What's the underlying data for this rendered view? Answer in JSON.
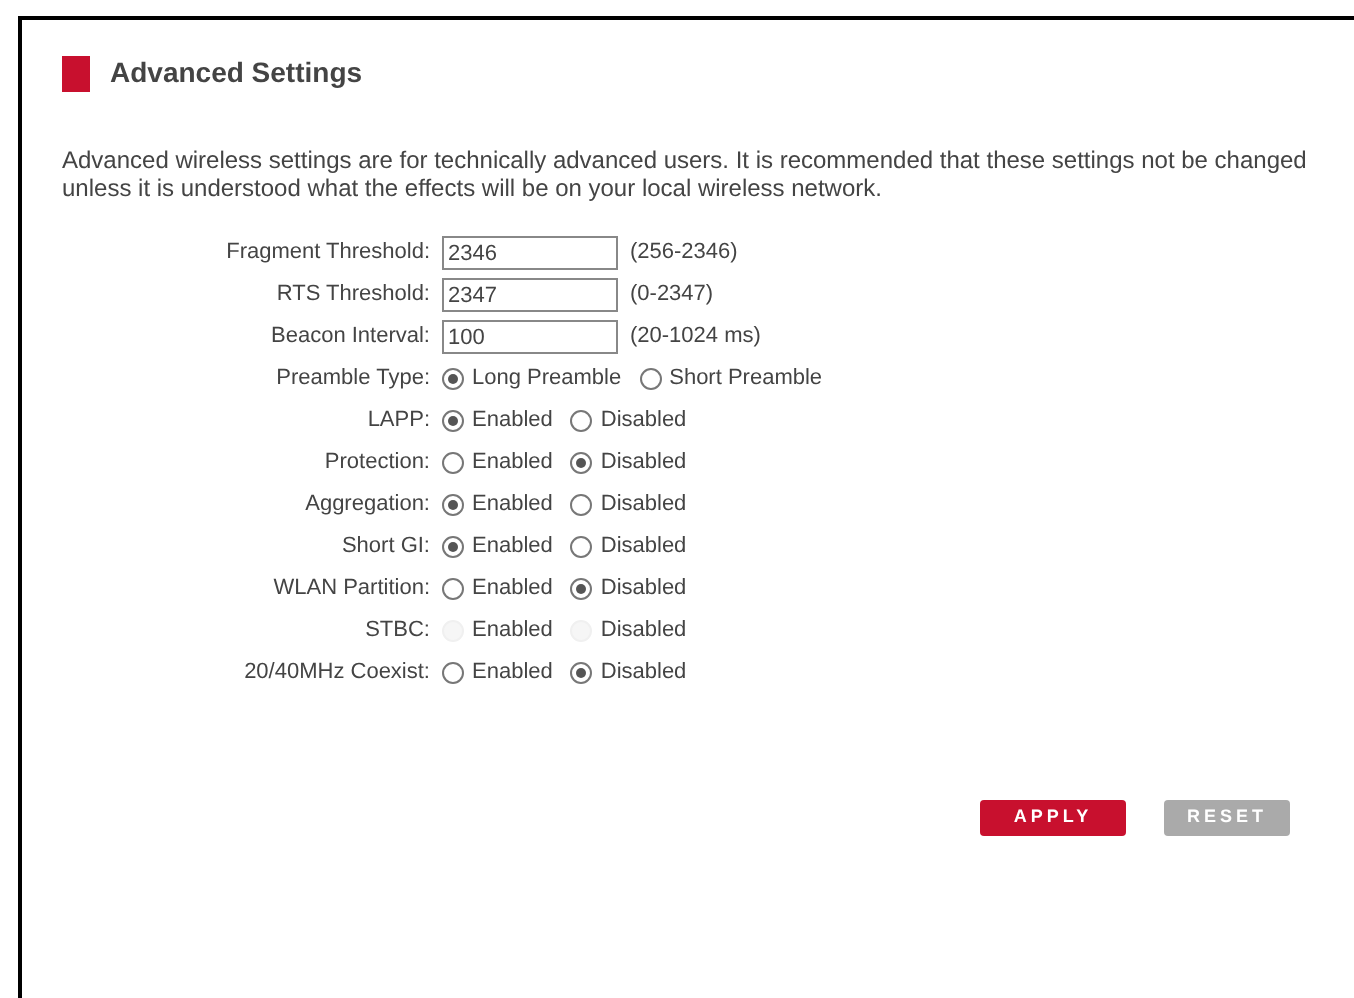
{
  "title": "Advanced Settings",
  "description": "Advanced wireless settings are for technically advanced users. It is recommended that these settings not be changed unless it is understood what the effects will be on your local wireless network.",
  "fields": [
    {
      "label": "Fragment Threshold:",
      "value": "2346",
      "hint": "(256-2346)"
    },
    {
      "label": "RTS Threshold:",
      "value": "2347",
      "hint": "(0-2347)"
    },
    {
      "label": "Beacon Interval:",
      "value": "100",
      "hint": "(20-1024 ms)"
    }
  ],
  "options": [
    {
      "label": "Preamble Type:",
      "disabled": false,
      "choices": [
        {
          "label": "Long Preamble",
          "selected": true
        },
        {
          "label": "Short Preamble",
          "selected": false
        }
      ]
    },
    {
      "label": "LAPP:",
      "disabled": false,
      "choices": [
        {
          "label": "Enabled",
          "selected": true
        },
        {
          "label": "Disabled",
          "selected": false
        }
      ]
    },
    {
      "label": "Protection:",
      "disabled": false,
      "choices": [
        {
          "label": "Enabled",
          "selected": false
        },
        {
          "label": "Disabled",
          "selected": true
        }
      ]
    },
    {
      "label": "Aggregation:",
      "disabled": false,
      "choices": [
        {
          "label": "Enabled",
          "selected": true
        },
        {
          "label": "Disabled",
          "selected": false
        }
      ]
    },
    {
      "label": "Short GI:",
      "disabled": false,
      "choices": [
        {
          "label": "Enabled",
          "selected": true
        },
        {
          "label": "Disabled",
          "selected": false
        }
      ]
    },
    {
      "label": "WLAN Partition:",
      "disabled": false,
      "choices": [
        {
          "label": "Enabled",
          "selected": false
        },
        {
          "label": "Disabled",
          "selected": true
        }
      ]
    },
    {
      "label": "STBC:",
      "disabled": true,
      "choices": [
        {
          "label": "Enabled",
          "selected": false
        },
        {
          "label": "Disabled",
          "selected": false
        }
      ]
    },
    {
      "label": "20/40MHz Coexist:",
      "disabled": false,
      "choices": [
        {
          "label": "Enabled",
          "selected": false
        },
        {
          "label": "Disabled",
          "selected": true
        }
      ]
    }
  ],
  "buttons": [
    {
      "label": "APPLY",
      "kind": "primary"
    },
    {
      "label": "RESET",
      "kind": "secondary"
    }
  ]
}
